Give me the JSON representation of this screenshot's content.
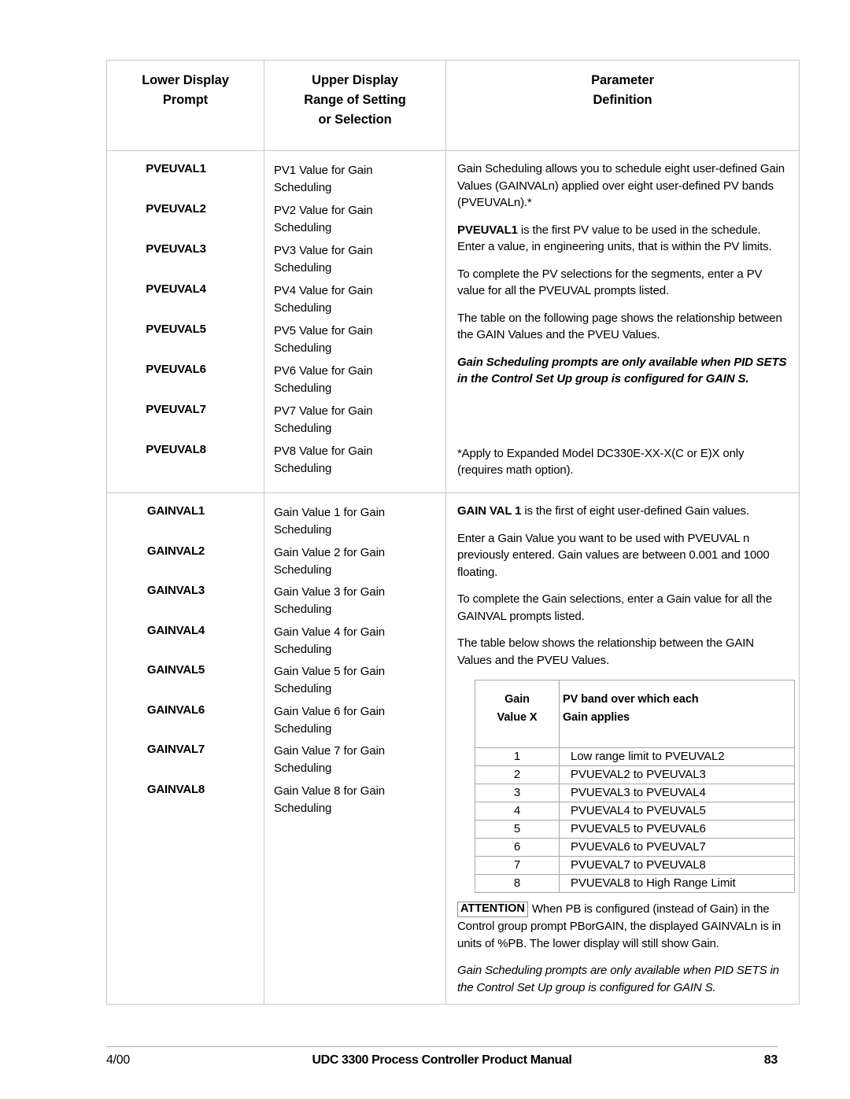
{
  "table": {
    "headers": [
      "Lower Display\nPrompt",
      "Upper Display\nRange of Setting\nor Selection",
      "Parameter\nDefinition"
    ],
    "header_lines": {
      "col1": [
        "Lower Display",
        "Prompt"
      ],
      "col2": [
        "Upper Display",
        "Range of Setting",
        "or Selection"
      ],
      "col3": [
        "Parameter",
        "Definition"
      ]
    },
    "sections": [
      {
        "id": "pveuval",
        "prompts": [
          "PVEUVAL1",
          "PVEUVAL2",
          "PVEUVAL3",
          "PVEUVAL4",
          "PVEUVAL5",
          "PVEUVAL6",
          "PVEUVAL7",
          "PVEUVAL8"
        ],
        "ranges": [
          [
            "PV1 Value for Gain",
            "Scheduling"
          ],
          [
            "PV2 Value for Gain",
            "Scheduling"
          ],
          [
            "PV3 Value for Gain",
            "Scheduling"
          ],
          [
            "PV4 Value for Gain",
            "Scheduling"
          ],
          [
            "PV5 Value for Gain",
            "Scheduling"
          ],
          [
            "PV6 Value for Gain",
            "Scheduling"
          ],
          [
            "PV7 Value for Gain",
            "Scheduling"
          ],
          [
            "PV8 Value for Gain",
            "Scheduling"
          ]
        ],
        "definition": {
          "p1": "Gain Scheduling allows you to schedule eight user-defined Gain Values (GAINVALn) applied over eight user-defined PV bands (PVEUVALn).*",
          "p2_bold": "PVEUVAL1",
          "p2_rest": " is the first PV value to be used in the schedule. Enter a value, in engineering units, that is within the PV limits.",
          "p3": "To complete the PV selections for the segments, enter a PV value for all the PVEUVAL prompts listed.",
          "p4": "The table on the following page shows the relationship between the GAIN Values and the PVEU Values.",
          "note_bold_italic": "Gain Scheduling prompts are only available when PID SETS in the Control Set Up group is configured for GAIN S.",
          "footnote": "*Apply to Expanded Model DC330E-XX-X(C or E)X only (requires math option)."
        }
      },
      {
        "id": "gainval",
        "prompts": [
          "GAINVAL1",
          "GAINVAL2",
          "GAINVAL3",
          "GAINVAL4",
          "GAINVAL5",
          "GAINVAL6",
          "GAINVAL7",
          "GAINVAL8"
        ],
        "ranges": [
          [
            "Gain Value 1 for Gain",
            "Scheduling"
          ],
          [
            "Gain Value 2 for Gain",
            "Scheduling"
          ],
          [
            "Gain Value 3 for Gain",
            "Scheduling"
          ],
          [
            "Gain Value 4 for Gain",
            "Scheduling"
          ],
          [
            "Gain Value 5 for Gain",
            "Scheduling"
          ],
          [
            "Gain Value 6 for Gain",
            "Scheduling"
          ],
          [
            "Gain Value 7 for Gain",
            "Scheduling"
          ],
          [
            "Gain Value 8 for Gain",
            "Scheduling"
          ]
        ],
        "definition": {
          "p1_bold": "GAIN VAL 1",
          "p1_rest": " is the first of eight user-defined Gain values.",
          "p2": "Enter a Gain Value you want to be used with PVEUVAL n previously entered. Gain values are between 0.001 and 1000 floating.",
          "p3": "To complete the Gain selections, enter a Gain value for all the GAINVAL prompts listed.",
          "p4": "The table below shows the relationship between the GAIN Values and the PVEU Values.",
          "attention_tag": "ATTENTION",
          "attention_text": "When PB is configured (instead of Gain) in the Control group prompt PBorGAIN, the displayed GAINVALn is in units of %PB. The lower display will still show Gain.",
          "note_italic": "Gain Scheduling prompts are only available when PID SETS in the Control Set Up group is configured for GAIN S."
        },
        "inner_table": {
          "headers": {
            "gain": [
              "Gain",
              "Value X"
            ],
            "band": [
              "PV band over which each",
              "Gain applies"
            ]
          },
          "rows": [
            {
              "value": "1",
              "band": "Low range limit to PVEUVAL2"
            },
            {
              "value": "2",
              "band": "PVUEVAL2 to PVEUVAL3"
            },
            {
              "value": "3",
              "band": "PVUEVAL3 to PVEUVAL4"
            },
            {
              "value": "4",
              "band": "PVUEVAL4 to PVEUVAL5"
            },
            {
              "value": "5",
              "band": "PVUEVAL5 to PVEUVAL6"
            },
            {
              "value": "6",
              "band": "PVUEVAL6 to PVEUVAL7"
            },
            {
              "value": "7",
              "band": "PVUEVAL7 to PVEUVAL8"
            },
            {
              "value": "8",
              "band": "PVUEVAL8 to High Range Limit"
            }
          ]
        }
      }
    ]
  },
  "footer": {
    "date": "4/00",
    "title": "UDC 3300 Process Controller Product Manual",
    "page_number": "83"
  }
}
